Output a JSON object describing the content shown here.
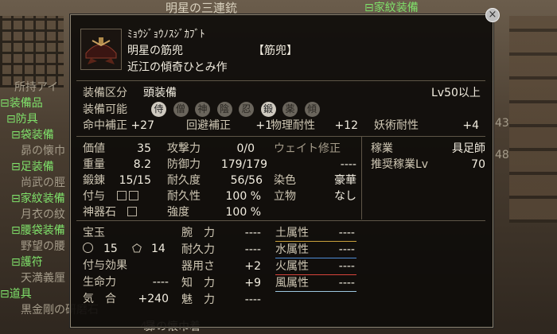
{
  "top_title": "明星の三連銃",
  "background": {
    "left": [
      {
        "text": "所持アイ",
        "cls": "dim"
      },
      {
        "text": "⊟装備品",
        "cls": "g"
      },
      {
        "text": "⊟防具",
        "cls": "g"
      },
      {
        "text": "⊟袋装備",
        "cls": "g"
      },
      {
        "text": "昴の懐巾",
        "cls": "dim"
      },
      {
        "text": "⊟足装備",
        "cls": "g"
      },
      {
        "text": "尚武の脛",
        "cls": "dim"
      },
      {
        "text": "⊟家紋装備",
        "cls": "g"
      },
      {
        "text": "月衣の紋",
        "cls": "dim"
      },
      {
        "text": "⊟腰袋装備",
        "cls": "g"
      },
      {
        "text": "野望の腰",
        "cls": "dim"
      },
      {
        "text": "⊟護符",
        "cls": "g"
      },
      {
        "text": "天満義厘",
        "cls": "dim"
      },
      {
        "text": "⊟道具",
        "cls": "g"
      },
      {
        "text": "黒金剛の研磨石",
        "cls": "dim"
      }
    ],
    "right_top": "⊟家紋装備",
    "right_nums": [
      "43",
      "48"
    ],
    "bottom_mid": "昴の懐巾着",
    "bottom_num": "43"
  },
  "item": {
    "reading": "ﾐｮｳｼﾞｮｳﾉｽｼﾞｶﾌﾞﾄ",
    "name": "明星の筋兜",
    "type": "【筋兜】",
    "maker": "近江の傾奇ひとみ作"
  },
  "equip": {
    "category_label": "装備区分",
    "category_value": "頭装備",
    "level": "Lv50以上",
    "allowed_label": "装備可能",
    "classes": [
      {
        "ch": "侍",
        "on": true
      },
      {
        "ch": "僧",
        "on": false
      },
      {
        "ch": "神",
        "on": false
      },
      {
        "ch": "陰",
        "on": false
      },
      {
        "ch": "忍",
        "on": false
      },
      {
        "ch": "鍛",
        "on": true
      },
      {
        "ch": "薬",
        "on": false
      },
      {
        "ch": "傾",
        "on": false
      }
    ]
  },
  "bonus": [
    {
      "label": "命中補正",
      "value": "+27"
    },
    {
      "label": "回避補正",
      "value": "+1"
    },
    {
      "label": "物理耐性",
      "value": "+12"
    },
    {
      "label": "妖術耐性",
      "value": "+4"
    }
  ],
  "stats": {
    "price_label": "価値",
    "price": "35",
    "weight_label": "重量",
    "weight": "8.2",
    "forge_label": "鍛錬",
    "forge": "15/15",
    "attach_label": "付与",
    "jewel_label": "神器石",
    "atk_label": "攻撃力",
    "atk": "0/0",
    "def_label": "防御力",
    "def": "179/179",
    "dur_label": "耐久度",
    "dur": "56/56",
    "durr_label": "耐久性",
    "durr": "100 %",
    "str_label": "強度",
    "str": "100 %",
    "wmod_label": "ウェイト修正",
    "wmod": "----",
    "dye_label": "染色",
    "dye": "豪華",
    "stand_label": "立物",
    "stand": "なし",
    "job_label": "稼業",
    "job": "具足師",
    "recjob_label": "推奨稼業Lv",
    "recjob": "70"
  },
  "gems": {
    "label": "宝玉",
    "a": "15",
    "b": "14"
  },
  "effects_label": "付与効果",
  "attrs": [
    {
      "label": "生命力",
      "value": "----"
    },
    {
      "label": "気　合",
      "value": "+240"
    }
  ],
  "core": [
    {
      "label": "腕　力",
      "value": "----"
    },
    {
      "label": "耐久力",
      "value": "----"
    },
    {
      "label": "器用さ",
      "value": "+2"
    },
    {
      "label": "知　力",
      "value": "+9"
    },
    {
      "label": "魅　力",
      "value": "----"
    }
  ],
  "elements": [
    {
      "label": "土属性",
      "value": "----",
      "color": "#c9a13c"
    },
    {
      "label": "水属性",
      "value": "----",
      "color": "#4f8ed8"
    },
    {
      "label": "火属性",
      "value": "----",
      "color": "#d8443c"
    },
    {
      "label": "風属性",
      "value": "----",
      "color": "#9ec7e0"
    }
  ],
  "close": "×"
}
